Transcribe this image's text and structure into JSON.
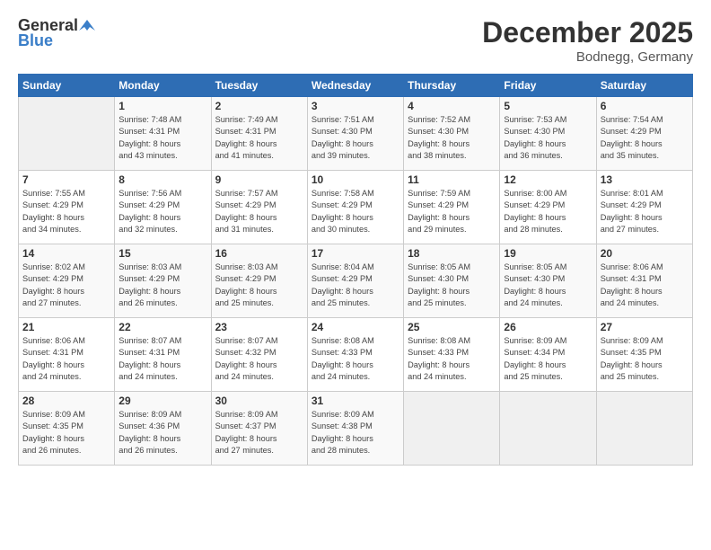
{
  "header": {
    "logo_general": "General",
    "logo_blue": "Blue",
    "month_title": "December 2025",
    "location": "Bodnegg, Germany"
  },
  "columns": [
    "Sunday",
    "Monday",
    "Tuesday",
    "Wednesday",
    "Thursday",
    "Friday",
    "Saturday"
  ],
  "weeks": [
    [
      {
        "day": "",
        "info": ""
      },
      {
        "day": "1",
        "info": "Sunrise: 7:48 AM\nSunset: 4:31 PM\nDaylight: 8 hours\nand 43 minutes."
      },
      {
        "day": "2",
        "info": "Sunrise: 7:49 AM\nSunset: 4:31 PM\nDaylight: 8 hours\nand 41 minutes."
      },
      {
        "day": "3",
        "info": "Sunrise: 7:51 AM\nSunset: 4:30 PM\nDaylight: 8 hours\nand 39 minutes."
      },
      {
        "day": "4",
        "info": "Sunrise: 7:52 AM\nSunset: 4:30 PM\nDaylight: 8 hours\nand 38 minutes."
      },
      {
        "day": "5",
        "info": "Sunrise: 7:53 AM\nSunset: 4:30 PM\nDaylight: 8 hours\nand 36 minutes."
      },
      {
        "day": "6",
        "info": "Sunrise: 7:54 AM\nSunset: 4:29 PM\nDaylight: 8 hours\nand 35 minutes."
      }
    ],
    [
      {
        "day": "7",
        "info": "Sunrise: 7:55 AM\nSunset: 4:29 PM\nDaylight: 8 hours\nand 34 minutes."
      },
      {
        "day": "8",
        "info": "Sunrise: 7:56 AM\nSunset: 4:29 PM\nDaylight: 8 hours\nand 32 minutes."
      },
      {
        "day": "9",
        "info": "Sunrise: 7:57 AM\nSunset: 4:29 PM\nDaylight: 8 hours\nand 31 minutes."
      },
      {
        "day": "10",
        "info": "Sunrise: 7:58 AM\nSunset: 4:29 PM\nDaylight: 8 hours\nand 30 minutes."
      },
      {
        "day": "11",
        "info": "Sunrise: 7:59 AM\nSunset: 4:29 PM\nDaylight: 8 hours\nand 29 minutes."
      },
      {
        "day": "12",
        "info": "Sunrise: 8:00 AM\nSunset: 4:29 PM\nDaylight: 8 hours\nand 28 minutes."
      },
      {
        "day": "13",
        "info": "Sunrise: 8:01 AM\nSunset: 4:29 PM\nDaylight: 8 hours\nand 27 minutes."
      }
    ],
    [
      {
        "day": "14",
        "info": "Sunrise: 8:02 AM\nSunset: 4:29 PM\nDaylight: 8 hours\nand 27 minutes."
      },
      {
        "day": "15",
        "info": "Sunrise: 8:03 AM\nSunset: 4:29 PM\nDaylight: 8 hours\nand 26 minutes."
      },
      {
        "day": "16",
        "info": "Sunrise: 8:03 AM\nSunset: 4:29 PM\nDaylight: 8 hours\nand 25 minutes."
      },
      {
        "day": "17",
        "info": "Sunrise: 8:04 AM\nSunset: 4:29 PM\nDaylight: 8 hours\nand 25 minutes."
      },
      {
        "day": "18",
        "info": "Sunrise: 8:05 AM\nSunset: 4:30 PM\nDaylight: 8 hours\nand 25 minutes."
      },
      {
        "day": "19",
        "info": "Sunrise: 8:05 AM\nSunset: 4:30 PM\nDaylight: 8 hours\nand 24 minutes."
      },
      {
        "day": "20",
        "info": "Sunrise: 8:06 AM\nSunset: 4:31 PM\nDaylight: 8 hours\nand 24 minutes."
      }
    ],
    [
      {
        "day": "21",
        "info": "Sunrise: 8:06 AM\nSunset: 4:31 PM\nDaylight: 8 hours\nand 24 minutes."
      },
      {
        "day": "22",
        "info": "Sunrise: 8:07 AM\nSunset: 4:31 PM\nDaylight: 8 hours\nand 24 minutes."
      },
      {
        "day": "23",
        "info": "Sunrise: 8:07 AM\nSunset: 4:32 PM\nDaylight: 8 hours\nand 24 minutes."
      },
      {
        "day": "24",
        "info": "Sunrise: 8:08 AM\nSunset: 4:33 PM\nDaylight: 8 hours\nand 24 minutes."
      },
      {
        "day": "25",
        "info": "Sunrise: 8:08 AM\nSunset: 4:33 PM\nDaylight: 8 hours\nand 24 minutes."
      },
      {
        "day": "26",
        "info": "Sunrise: 8:09 AM\nSunset: 4:34 PM\nDaylight: 8 hours\nand 25 minutes."
      },
      {
        "day": "27",
        "info": "Sunrise: 8:09 AM\nSunset: 4:35 PM\nDaylight: 8 hours\nand 25 minutes."
      }
    ],
    [
      {
        "day": "28",
        "info": "Sunrise: 8:09 AM\nSunset: 4:35 PM\nDaylight: 8 hours\nand 26 minutes."
      },
      {
        "day": "29",
        "info": "Sunrise: 8:09 AM\nSunset: 4:36 PM\nDaylight: 8 hours\nand 26 minutes."
      },
      {
        "day": "30",
        "info": "Sunrise: 8:09 AM\nSunset: 4:37 PM\nDaylight: 8 hours\nand 27 minutes."
      },
      {
        "day": "31",
        "info": "Sunrise: 8:09 AM\nSunset: 4:38 PM\nDaylight: 8 hours\nand 28 minutes."
      },
      {
        "day": "",
        "info": ""
      },
      {
        "day": "",
        "info": ""
      },
      {
        "day": "",
        "info": ""
      }
    ]
  ]
}
